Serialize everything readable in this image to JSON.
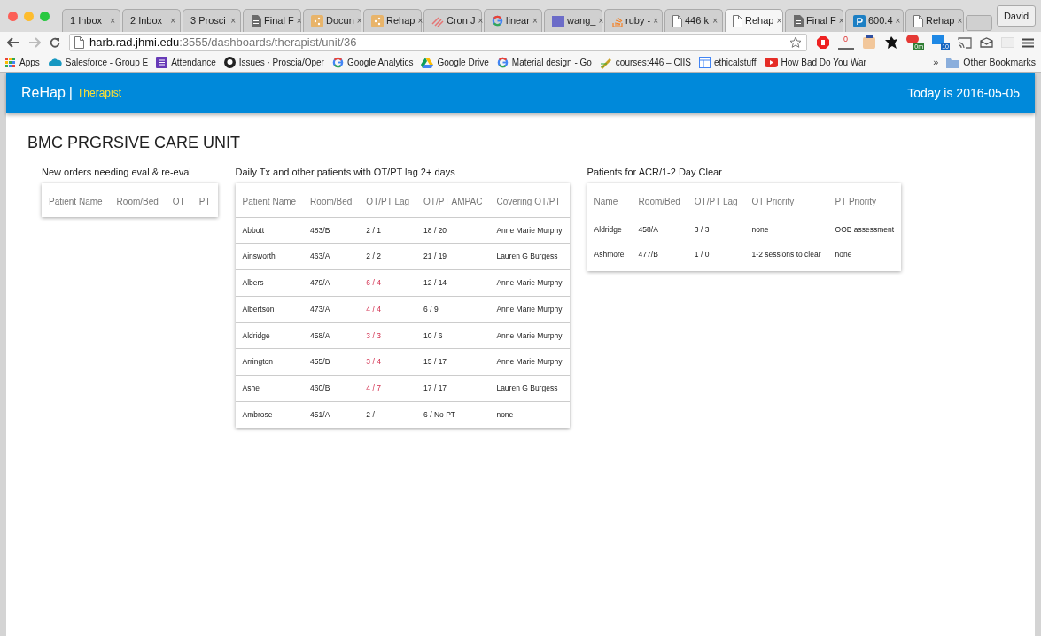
{
  "browser": {
    "tabs": [
      {
        "label": "1 Inbox",
        "kind": "none",
        "close": "×",
        "selected": false
      },
      {
        "label": "2 Inbox",
        "kind": "none",
        "close": "×",
        "selected": false
      },
      {
        "label": "3 Prosci",
        "kind": "none",
        "close": "×",
        "selected": false
      },
      {
        "label": "Final F",
        "kind": "gdoc",
        "close": "×",
        "selected": false
      },
      {
        "label": "Docun",
        "kind": "slides",
        "close": "×",
        "selected": false
      },
      {
        "label": "Rehap",
        "kind": "slides",
        "close": "×",
        "selected": false
      },
      {
        "label": "Cron J",
        "kind": "stripes",
        "close": "×",
        "selected": false
      },
      {
        "label": "linear",
        "kind": "google",
        "close": "×",
        "selected": false
      },
      {
        "label": "wang_",
        "kind": "square",
        "close": "×",
        "selected": false
      },
      {
        "label": "ruby -",
        "kind": "stack",
        "close": "×",
        "selected": false
      },
      {
        "label": "446 k",
        "kind": "page",
        "close": "×",
        "selected": false
      },
      {
        "label": "Rehap",
        "kind": "page",
        "close": "×",
        "selected": true
      },
      {
        "label": "Final F",
        "kind": "gdoc",
        "close": "×",
        "selected": false
      },
      {
        "label": "600.4",
        "kind": "p",
        "close": "×",
        "selected": false
      },
      {
        "label": "Rehap",
        "kind": "page",
        "close": "×",
        "selected": false
      }
    ],
    "profile": "David",
    "url_host": "harb.rad.jhmi.edu",
    "url_path": ":3555/dashboards/therapist/unit/36",
    "extension_badges": [
      "0",
      "0m",
      "10"
    ],
    "bookmarks": [
      {
        "label": "Apps",
        "kind": "grid"
      },
      {
        "label": "Salesforce - Group E",
        "kind": "cloud"
      },
      {
        "label": "Attendance",
        "kind": "form"
      },
      {
        "label": "Issues · Proscia/Oper",
        "kind": "github"
      },
      {
        "label": "Google Analytics",
        "kind": "google"
      },
      {
        "label": "Google Drive",
        "kind": "drive"
      },
      {
        "label": "Material design - Go",
        "kind": "google"
      },
      {
        "label": "courses:446 – CIIS",
        "kind": "pencil"
      },
      {
        "label": "ethicalstuff",
        "kind": "layout"
      },
      {
        "label": "How Bad Do You War",
        "kind": "youtube"
      }
    ],
    "bookmarks_overflow": "»",
    "other_bookmarks": "Other Bookmarks"
  },
  "app": {
    "brand": "ReHap",
    "separator": "|",
    "role": "Therapist",
    "today": "Today is 2016-05-05"
  },
  "unit_title": "BMC PRGRSIVE CARE UNIT",
  "new_orders": {
    "title": "New orders needing eval & re-eval",
    "columns": [
      "Patient Name",
      "Room/Bed",
      "OT",
      "PT"
    ]
  },
  "daily_tx": {
    "title": "Daily Tx and other patients with OT/PT lag 2+ days",
    "columns": [
      "Patient Name",
      "Room/Bed",
      "OT/PT Lag",
      "OT/PT AMPAC",
      "Covering OT/PT"
    ],
    "rows": [
      {
        "name": "Abbott",
        "room": "483/B",
        "lag": "2 / 1",
        "lag_alert": false,
        "ampac": "18 / 20",
        "covering": "Anne Marie Murphy"
      },
      {
        "name": "Ainsworth",
        "room": "463/A",
        "lag": "2 / 2",
        "lag_alert": false,
        "ampac": "21 / 19",
        "covering": "Lauren G Burgess"
      },
      {
        "name": "Albers",
        "room": "479/A",
        "lag": "6 / 4",
        "lag_alert": true,
        "ampac": "12 / 14",
        "covering": "Anne Marie Murphy"
      },
      {
        "name": "Albertson",
        "room": "473/A",
        "lag": "4 / 4",
        "lag_alert": true,
        "ampac": "6 / 9",
        "covering": "Anne Marie Murphy"
      },
      {
        "name": "Aldridge",
        "room": "458/A",
        "lag": "3 / 3",
        "lag_alert": true,
        "ampac": "10 / 6",
        "covering": "Anne Marie Murphy"
      },
      {
        "name": "Arrington",
        "room": "455/B",
        "lag": "3 / 4",
        "lag_alert": true,
        "ampac": "15 / 17",
        "covering": "Anne Marie Murphy"
      },
      {
        "name": "Ashe",
        "room": "460/B",
        "lag": "4 / 7",
        "lag_alert": true,
        "ampac": "17 / 17",
        "covering": "Lauren G Burgess"
      },
      {
        "name": "Ambrose",
        "room": "451/A",
        "lag": "2 / -",
        "lag_alert": false,
        "ampac": "6 / No PT",
        "covering": "none"
      }
    ]
  },
  "acr": {
    "title": "Patients for ACR/1-2 Day Clear",
    "columns": [
      "Name",
      "Room/Bed",
      "OT/PT Lag",
      "OT Priority",
      "PT Priority"
    ],
    "rows": [
      {
        "name": "Aldridge",
        "room": "458/A",
        "lag": "3 / 3",
        "ot_priority": "none",
        "pt_priority": "OOB assessment"
      },
      {
        "name": "Ashmore",
        "room": "477/B",
        "lag": "1 / 0",
        "ot_priority": "1-2 sessions to clear",
        "pt_priority": "none"
      }
    ]
  }
}
